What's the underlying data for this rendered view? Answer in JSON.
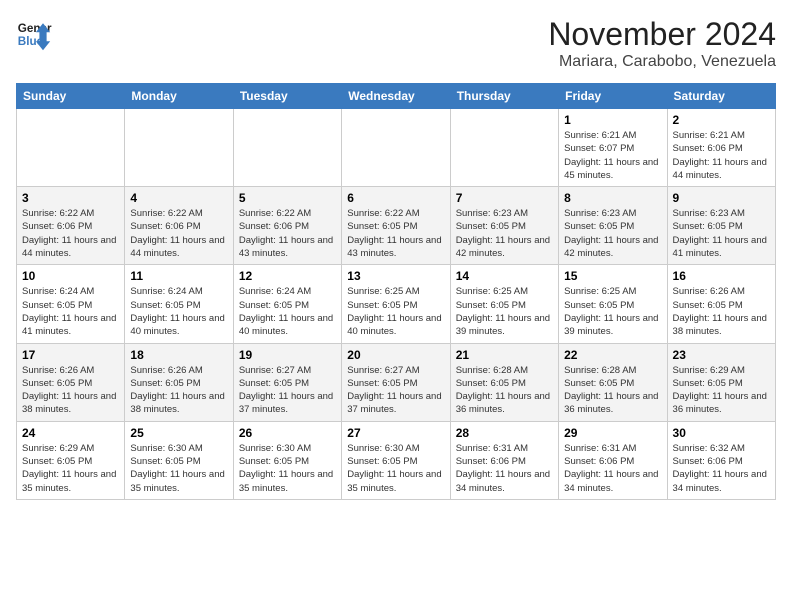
{
  "header": {
    "logo_line1": "General",
    "logo_line2": "Blue",
    "month": "November 2024",
    "location": "Mariara, Carabobo, Venezuela"
  },
  "weekdays": [
    "Sunday",
    "Monday",
    "Tuesday",
    "Wednesday",
    "Thursday",
    "Friday",
    "Saturday"
  ],
  "weeks": [
    [
      {
        "day": "",
        "info": ""
      },
      {
        "day": "",
        "info": ""
      },
      {
        "day": "",
        "info": ""
      },
      {
        "day": "",
        "info": ""
      },
      {
        "day": "",
        "info": ""
      },
      {
        "day": "1",
        "info": "Sunrise: 6:21 AM\nSunset: 6:07 PM\nDaylight: 11 hours and 45 minutes."
      },
      {
        "day": "2",
        "info": "Sunrise: 6:21 AM\nSunset: 6:06 PM\nDaylight: 11 hours and 44 minutes."
      }
    ],
    [
      {
        "day": "3",
        "info": "Sunrise: 6:22 AM\nSunset: 6:06 PM\nDaylight: 11 hours and 44 minutes."
      },
      {
        "day": "4",
        "info": "Sunrise: 6:22 AM\nSunset: 6:06 PM\nDaylight: 11 hours and 44 minutes."
      },
      {
        "day": "5",
        "info": "Sunrise: 6:22 AM\nSunset: 6:06 PM\nDaylight: 11 hours and 43 minutes."
      },
      {
        "day": "6",
        "info": "Sunrise: 6:22 AM\nSunset: 6:05 PM\nDaylight: 11 hours and 43 minutes."
      },
      {
        "day": "7",
        "info": "Sunrise: 6:23 AM\nSunset: 6:05 PM\nDaylight: 11 hours and 42 minutes."
      },
      {
        "day": "8",
        "info": "Sunrise: 6:23 AM\nSunset: 6:05 PM\nDaylight: 11 hours and 42 minutes."
      },
      {
        "day": "9",
        "info": "Sunrise: 6:23 AM\nSunset: 6:05 PM\nDaylight: 11 hours and 41 minutes."
      }
    ],
    [
      {
        "day": "10",
        "info": "Sunrise: 6:24 AM\nSunset: 6:05 PM\nDaylight: 11 hours and 41 minutes."
      },
      {
        "day": "11",
        "info": "Sunrise: 6:24 AM\nSunset: 6:05 PM\nDaylight: 11 hours and 40 minutes."
      },
      {
        "day": "12",
        "info": "Sunrise: 6:24 AM\nSunset: 6:05 PM\nDaylight: 11 hours and 40 minutes."
      },
      {
        "day": "13",
        "info": "Sunrise: 6:25 AM\nSunset: 6:05 PM\nDaylight: 11 hours and 40 minutes."
      },
      {
        "day": "14",
        "info": "Sunrise: 6:25 AM\nSunset: 6:05 PM\nDaylight: 11 hours and 39 minutes."
      },
      {
        "day": "15",
        "info": "Sunrise: 6:25 AM\nSunset: 6:05 PM\nDaylight: 11 hours and 39 minutes."
      },
      {
        "day": "16",
        "info": "Sunrise: 6:26 AM\nSunset: 6:05 PM\nDaylight: 11 hours and 38 minutes."
      }
    ],
    [
      {
        "day": "17",
        "info": "Sunrise: 6:26 AM\nSunset: 6:05 PM\nDaylight: 11 hours and 38 minutes."
      },
      {
        "day": "18",
        "info": "Sunrise: 6:26 AM\nSunset: 6:05 PM\nDaylight: 11 hours and 38 minutes."
      },
      {
        "day": "19",
        "info": "Sunrise: 6:27 AM\nSunset: 6:05 PM\nDaylight: 11 hours and 37 minutes."
      },
      {
        "day": "20",
        "info": "Sunrise: 6:27 AM\nSunset: 6:05 PM\nDaylight: 11 hours and 37 minutes."
      },
      {
        "day": "21",
        "info": "Sunrise: 6:28 AM\nSunset: 6:05 PM\nDaylight: 11 hours and 36 minutes."
      },
      {
        "day": "22",
        "info": "Sunrise: 6:28 AM\nSunset: 6:05 PM\nDaylight: 11 hours and 36 minutes."
      },
      {
        "day": "23",
        "info": "Sunrise: 6:29 AM\nSunset: 6:05 PM\nDaylight: 11 hours and 36 minutes."
      }
    ],
    [
      {
        "day": "24",
        "info": "Sunrise: 6:29 AM\nSunset: 6:05 PM\nDaylight: 11 hours and 35 minutes."
      },
      {
        "day": "25",
        "info": "Sunrise: 6:30 AM\nSunset: 6:05 PM\nDaylight: 11 hours and 35 minutes."
      },
      {
        "day": "26",
        "info": "Sunrise: 6:30 AM\nSunset: 6:05 PM\nDaylight: 11 hours and 35 minutes."
      },
      {
        "day": "27",
        "info": "Sunrise: 6:30 AM\nSunset: 6:05 PM\nDaylight: 11 hours and 35 minutes."
      },
      {
        "day": "28",
        "info": "Sunrise: 6:31 AM\nSunset: 6:06 PM\nDaylight: 11 hours and 34 minutes."
      },
      {
        "day": "29",
        "info": "Sunrise: 6:31 AM\nSunset: 6:06 PM\nDaylight: 11 hours and 34 minutes."
      },
      {
        "day": "30",
        "info": "Sunrise: 6:32 AM\nSunset: 6:06 PM\nDaylight: 11 hours and 34 minutes."
      }
    ]
  ]
}
